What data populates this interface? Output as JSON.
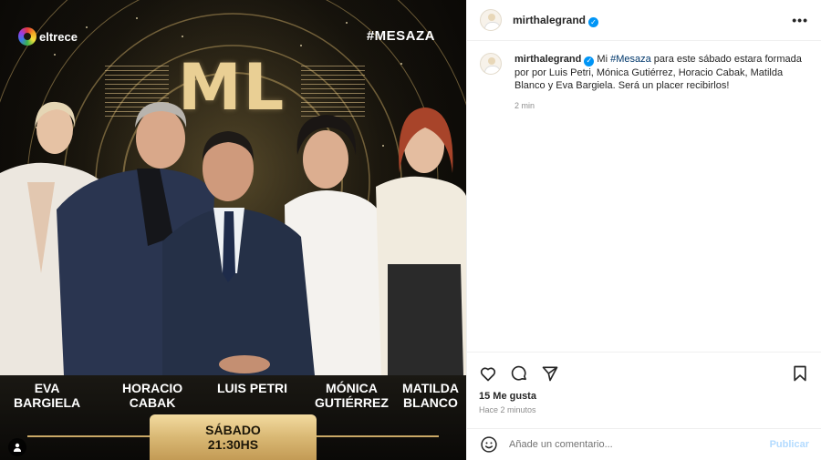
{
  "post": {
    "channel_logo_text": "eltrece",
    "hashtag": "#MESAZA",
    "show_logo": "ML",
    "guests": [
      {
        "line1": "EVA",
        "line2": "BARGIELA"
      },
      {
        "line1": "HORACIO",
        "line2": "CABAK"
      },
      {
        "line1": "LUIS PETRI",
        "line2": ""
      },
      {
        "line1": "MÓNICA",
        "line2": "GUTIÉRREZ"
      },
      {
        "line1": "MATILDA",
        "line2": "BLANCO"
      }
    ],
    "day": "SÁBADO",
    "hour": "21:30HS"
  },
  "header": {
    "username": "mirthalegrand"
  },
  "caption": {
    "username": "mirthalegrand",
    "text_before": "Mi ",
    "hashtag": "#Mesaza",
    "text_after": " para este sábado estara formada por por Luis Petri, Mónica Gutiérrez, Horacio Cabak, Matilda Blanco y Eva Bargiela. Será un placer recibirlos!",
    "time": "2 min"
  },
  "actions": {
    "likes": "15 Me gusta",
    "time_ago": "Hace 2 minutos"
  },
  "comment": {
    "placeholder": "Añade un comentario...",
    "publish": "Publicar"
  },
  "colors": {
    "gold": "#d9b874",
    "verified": "#0095f6",
    "hashtag_link": "#00376b",
    "publish_disabled": "#b3dbff"
  }
}
